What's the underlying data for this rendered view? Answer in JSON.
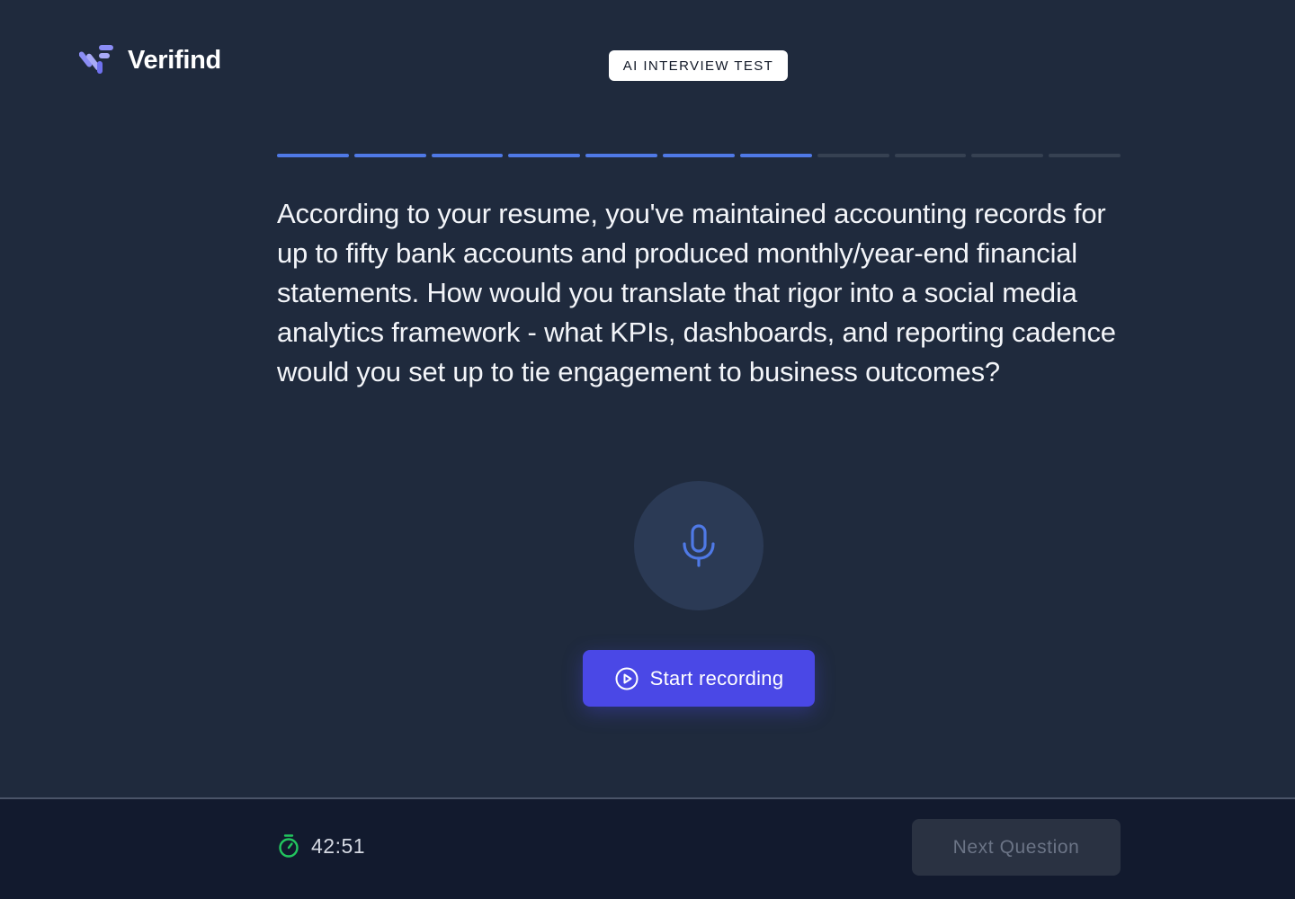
{
  "brand": {
    "name": "Verifind",
    "icon": "verifind-logo-icon",
    "accent": "#7b7cf0"
  },
  "badge": {
    "label": "AI INTERVIEW TEST"
  },
  "progress": {
    "total_steps": 11,
    "completed_steps": 7,
    "done_color": "#4f79e6",
    "pending_color": "#364152"
  },
  "question": {
    "text": "According to your resume, you've maintained accounting records for up to fifty bank accounts and produced monthly/year-end financial statements. How would you translate that rigor into a social media analytics framework - what KPIs, dashboards, and reporting cadence would you set up to tie engagement to business outcomes?"
  },
  "microphone": {
    "icon": "microphone-icon",
    "color": "#4f79e6"
  },
  "record_button": {
    "label": "Start recording",
    "icon": "play-circle-icon",
    "color": "#4a48e6"
  },
  "footer": {
    "timer": {
      "icon": "stopwatch-icon",
      "value": "42:51",
      "icon_color": "#22c55e"
    },
    "next_button": {
      "label": "Next Question",
      "disabled": true
    }
  }
}
